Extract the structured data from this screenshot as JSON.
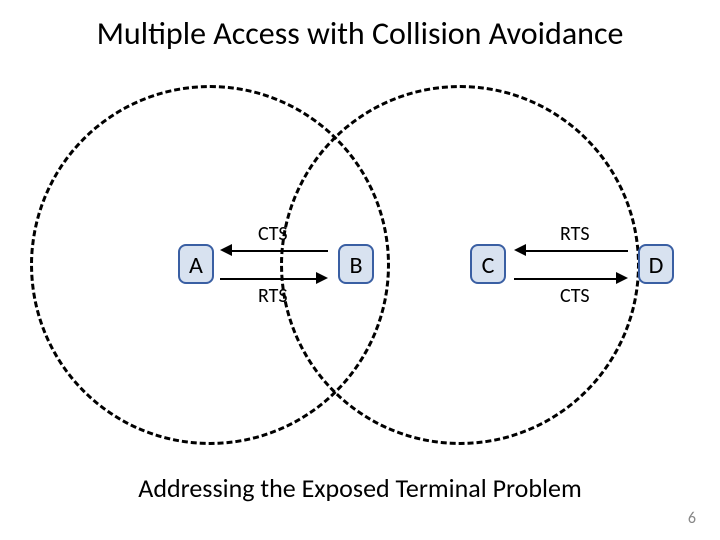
{
  "title": "Multiple Access with Collision Avoidance",
  "subtitle": "Addressing the Exposed Terminal Problem",
  "slide_number": "6",
  "nodes": {
    "a": "A",
    "b": "B",
    "c": "C",
    "d": "D"
  },
  "messages": {
    "ab_top": "CTS",
    "ab_bottom": "RTS",
    "cd_top": "RTS",
    "cd_bottom": "CTS"
  }
}
